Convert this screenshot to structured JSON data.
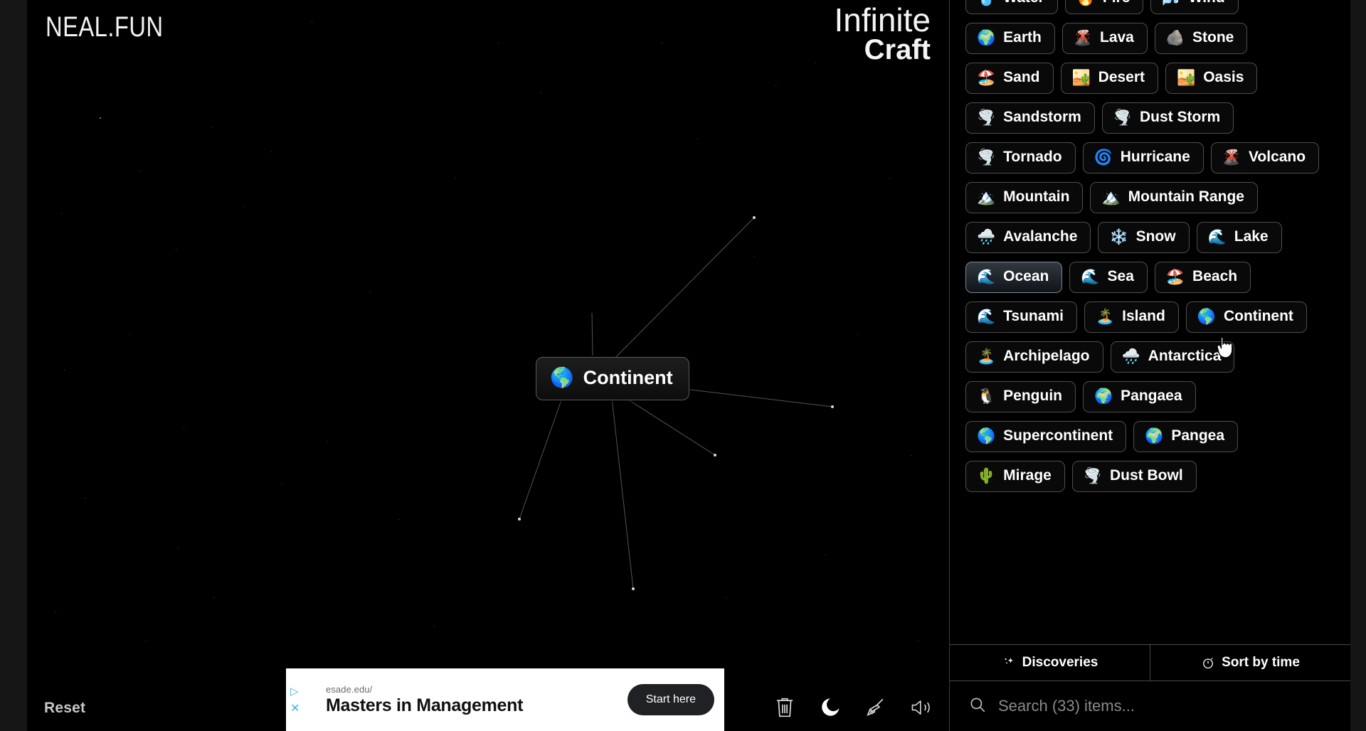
{
  "brand": "NEAL.FUN",
  "game_title": {
    "line1": "Infinite",
    "line2": "Craft"
  },
  "canvas": {
    "reset_label": "Reset",
    "node": {
      "emoji": "🌎",
      "label": "Continent"
    }
  },
  "ad": {
    "url": "esade.edu/",
    "headline": "Masters in Management",
    "cta": "Start here",
    "adchoices_icon": "adchoices-triangle-icon",
    "close_icon": "close-x-icon"
  },
  "toolbar": [
    {
      "name": "trash-icon",
      "label": "Delete"
    },
    {
      "name": "moon-icon",
      "label": "Dark mode"
    },
    {
      "name": "broom-icon",
      "label": "Clear board"
    },
    {
      "name": "speaker-icon",
      "label": "Sound"
    }
  ],
  "sidebar": {
    "items": [
      {
        "emoji": "💧",
        "label": "Water",
        "hovered": false
      },
      {
        "emoji": "🔥",
        "label": "Fire",
        "hovered": false
      },
      {
        "emoji": "🌬️",
        "label": "Wind",
        "hovered": false
      },
      {
        "emoji": "🌍",
        "label": "Earth",
        "hovered": false
      },
      {
        "emoji": "🌋",
        "label": "Lava",
        "hovered": false
      },
      {
        "emoji": "🪨",
        "label": "Stone",
        "hovered": false
      },
      {
        "emoji": "🏖️",
        "label": "Sand",
        "hovered": false
      },
      {
        "emoji": "🏜️",
        "label": "Desert",
        "hovered": false
      },
      {
        "emoji": "🏜️",
        "label": "Oasis",
        "hovered": false
      },
      {
        "emoji": "🌪️",
        "label": "Sandstorm",
        "hovered": false
      },
      {
        "emoji": "🌪️",
        "label": "Dust Storm",
        "hovered": false
      },
      {
        "emoji": "🌪️",
        "label": "Tornado",
        "hovered": false
      },
      {
        "emoji": "🌀",
        "label": "Hurricane",
        "hovered": false
      },
      {
        "emoji": "🌋",
        "label": "Volcano",
        "hovered": false
      },
      {
        "emoji": "🏔️",
        "label": "Mountain",
        "hovered": false
      },
      {
        "emoji": "🏔️",
        "label": "Mountain Range",
        "hovered": false
      },
      {
        "emoji": "🌧️",
        "label": "Avalanche",
        "hovered": false
      },
      {
        "emoji": "❄️",
        "label": "Snow",
        "hovered": false
      },
      {
        "emoji": "🌊",
        "label": "Lake",
        "hovered": false
      },
      {
        "emoji": "🌊",
        "label": "Ocean",
        "hovered": true
      },
      {
        "emoji": "🌊",
        "label": "Sea",
        "hovered": false
      },
      {
        "emoji": "🏖️",
        "label": "Beach",
        "hovered": false
      },
      {
        "emoji": "🌊",
        "label": "Tsunami",
        "hovered": false
      },
      {
        "emoji": "🏝️",
        "label": "Island",
        "hovered": false
      },
      {
        "emoji": "🌎",
        "label": "Continent",
        "hovered": false
      },
      {
        "emoji": "🏝️",
        "label": "Archipelago",
        "hovered": false
      },
      {
        "emoji": "🌧️",
        "label": "Antarctica",
        "hovered": false
      },
      {
        "emoji": "🐧",
        "label": "Penguin",
        "hovered": false
      },
      {
        "emoji": "🌍",
        "label": "Pangaea",
        "hovered": false
      },
      {
        "emoji": "🌎",
        "label": "Supercontinent",
        "hovered": false
      },
      {
        "emoji": "🌍",
        "label": "Pangea",
        "hovered": false
      },
      {
        "emoji": "🌵",
        "label": "Mirage",
        "hovered": false
      },
      {
        "emoji": "🌪️",
        "label": "Dust Bowl",
        "hovered": false
      }
    ],
    "tabs": [
      {
        "icon": "sparkle-icon",
        "label": "Discoveries"
      },
      {
        "icon": "stopwatch-icon",
        "label": "Sort by time"
      }
    ],
    "search_placeholder": "Search (33) items...",
    "search_value": ""
  },
  "colors": {
    "background": "#000000",
    "item_border": "#4e4e4e",
    "hover_border": "#7d8691",
    "text": "#ffffff",
    "muted_text": "#8a8a8a",
    "ad_background": "#ffffff",
    "ad_cta": "#202124"
  }
}
